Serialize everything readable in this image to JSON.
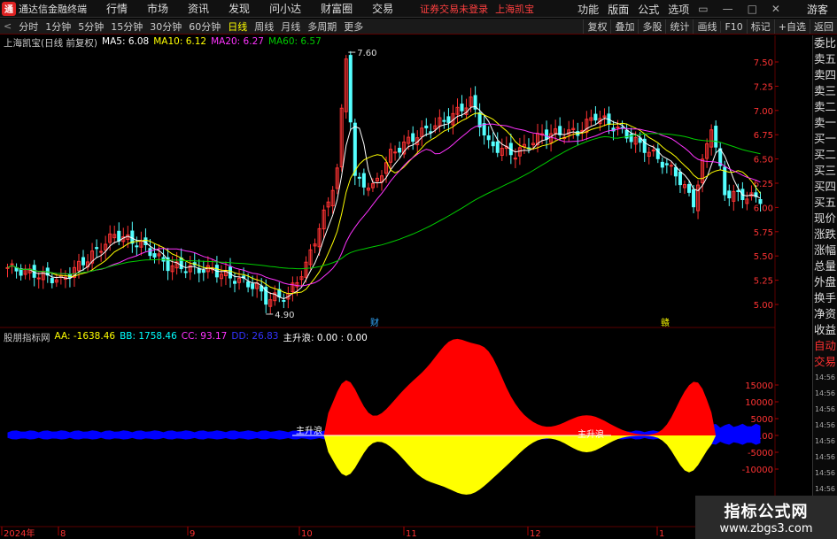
{
  "app": {
    "title": "通达信金融终端",
    "menus": [
      "行情",
      "市场",
      "资讯",
      "发现",
      "问小达",
      "财富圈",
      "交易"
    ],
    "notice": "证券交易未登录",
    "stock": "上海凯宝",
    "right_menus": [
      "功能",
      "版面",
      "公式",
      "选项"
    ],
    "guest": "游客",
    "win_controls": [
      "▭",
      "—",
      "□",
      "✕"
    ]
  },
  "toolbar": {
    "nav": "<",
    "periods": [
      "分时",
      "1分钟",
      "5分钟",
      "15分钟",
      "30分钟",
      "60分钟",
      "日线",
      "周线",
      "月线",
      "多周期",
      "更多"
    ],
    "active": "日线",
    "right_buttons": [
      "复权",
      "叠加",
      "多股",
      "统计",
      "画线",
      "F10",
      "标记",
      "+自选",
      "返回"
    ]
  },
  "main_legend": {
    "title": "上海凯宝(日线 前复权)",
    "ma5": "MA5: 6.08",
    "ma10": "MA10: 6.12",
    "ma20": "MA20: 6.27",
    "ma60": "MA60: 6.57"
  },
  "colors": {
    "up": "#ff3333",
    "down": "#54ffff",
    "ma5": "#ffffff",
    "ma10": "#ffff00",
    "ma20": "#ff33ff",
    "ma60": "#00cc00",
    "positive": "#ff0000",
    "yellow": "#ffff00",
    "blue": "#0000ff"
  },
  "price_axis": [
    "7.50",
    "7.25",
    "7.00",
    "6.75",
    "6.50",
    "6.25",
    "6.00",
    "5.75",
    "5.50",
    "5.25",
    "5.00"
  ],
  "annotations": {
    "high": "7.60",
    "low": "4.90",
    "fin1": "财",
    "fin2": "赣"
  },
  "indicator_legend": {
    "name": "股朋指标网",
    "aa": "AA: -1638.46",
    "bb": "BB: 1758.46",
    "cc": "CC: 93.17",
    "dd": "DD: 26.83",
    "zs": "主升浪: 0.00 : 0.00"
  },
  "indicator_axis": [
    "15000",
    "10000",
    "5000",
    "0.00",
    "-5000",
    "-10000"
  ],
  "indicator_labels": [
    "主升浪",
    "主升浪"
  ],
  "date_axis": [
    "2024年",
    "8",
    "9",
    "10",
    "11",
    "12",
    "1"
  ],
  "side": [
    "委比",
    "卖五",
    "卖四",
    "卖三",
    "卖二",
    "卖一",
    "买一",
    "买二",
    "买三",
    "买四",
    "买五",
    "现价",
    "涨跌",
    "涨幅",
    "总量",
    "外盘",
    "换手",
    "净资",
    "收益",
    "自动",
    "交易",
    "14:56",
    "14:56",
    "14:56",
    "14:56",
    "14:56",
    "14:56",
    "14:56",
    "14:56"
  ],
  "watermark": {
    "line1": "指标公式网",
    "line2": "www.zbgs3.com"
  }
}
